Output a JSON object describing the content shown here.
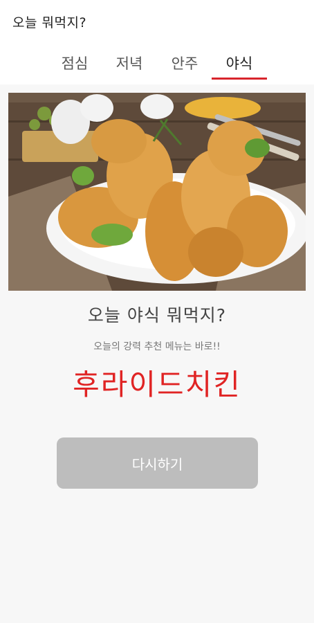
{
  "app": {
    "title": "오늘 뭐먹지?"
  },
  "tabs": [
    {
      "label": "점심",
      "active": false
    },
    {
      "label": "저녁",
      "active": false
    },
    {
      "label": "안주",
      "active": false
    },
    {
      "label": "야식",
      "active": true
    }
  ],
  "colors": {
    "accent": "#d8242c",
    "result": "#e02424",
    "button": "#bdbdbd"
  },
  "hero": {
    "image_icon": "fried-chicken-photo"
  },
  "main": {
    "headline": "오늘 야식 뭐먹지?",
    "subline": "오늘의 강력 추천 메뉴는 바로!!",
    "result": "후라이드치킨",
    "retry_label": "다시하기"
  }
}
